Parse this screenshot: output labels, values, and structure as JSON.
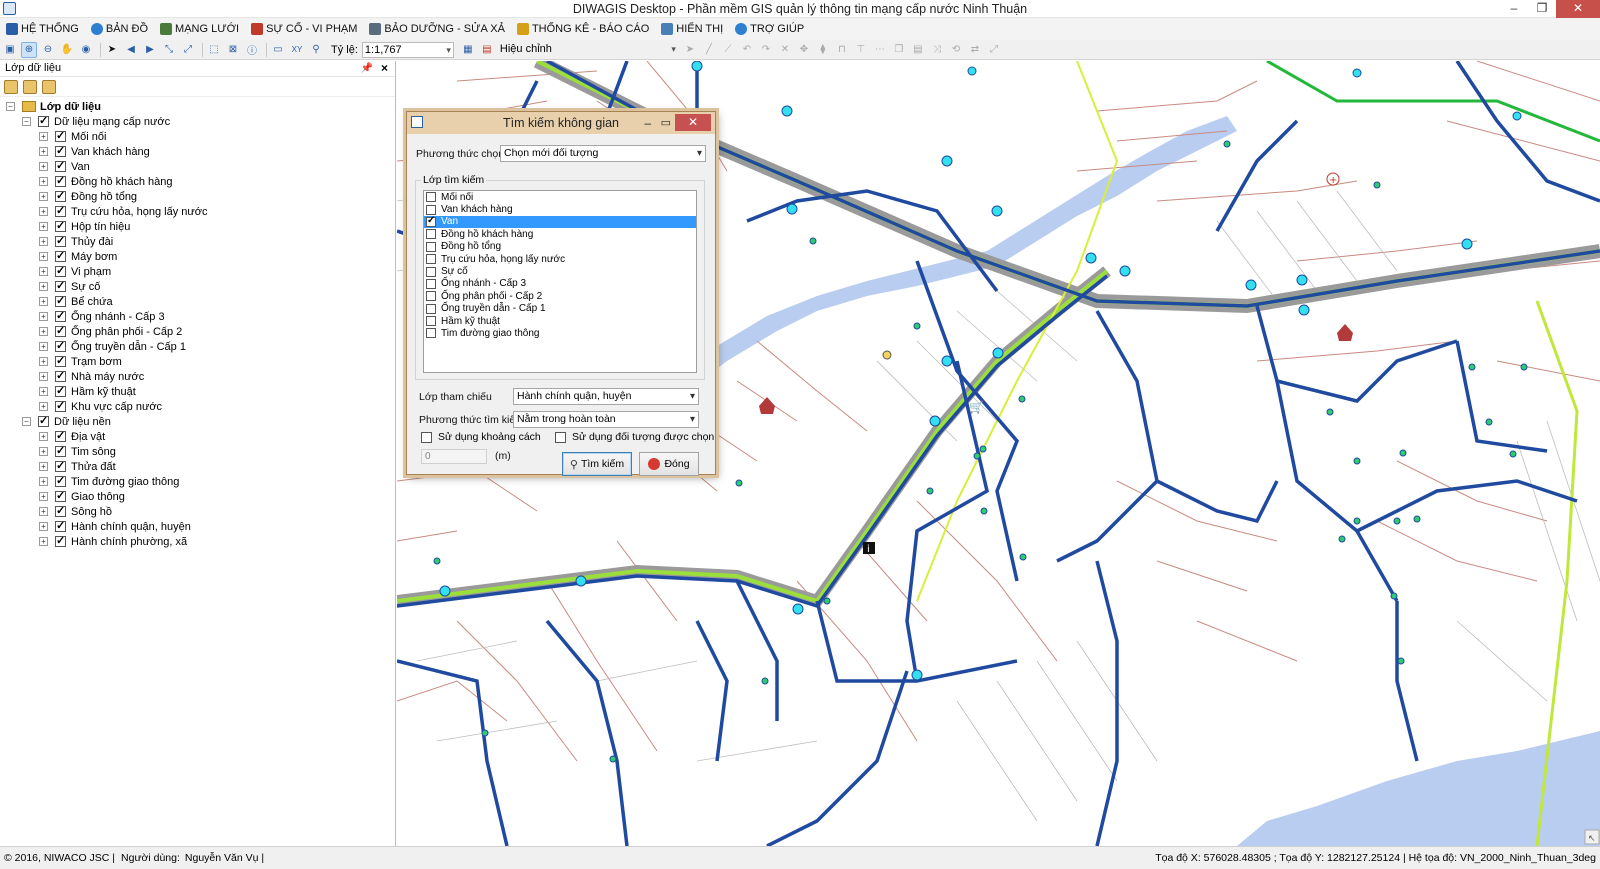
{
  "window": {
    "title": "DIWAGIS Desktop - Phần mềm GIS quản lý thông tin mạng cấp nước Ninh Thuận",
    "controls": {
      "minimize": "–",
      "maximize": "❐",
      "close": "✕"
    }
  },
  "menu": [
    {
      "label": "HỆ THỐNG",
      "icon": "system-icon",
      "color": "#2a5fa8"
    },
    {
      "label": "BẢN ĐỒ",
      "icon": "globe-icon",
      "color": "#2f7fd1"
    },
    {
      "label": "MẠNG LƯỚI",
      "icon": "network-icon",
      "color": "#4b7b3a"
    },
    {
      "label": "SỰ CỐ - VI PHẠM",
      "icon": "flag-icon",
      "color": "#c0392b"
    },
    {
      "label": "BẢO DƯỠNG - SỬA XẢ",
      "icon": "wrench-icon",
      "color": "#5a6b7d"
    },
    {
      "label": "THỐNG KÊ - BÁO CÁO",
      "icon": "report-icon",
      "color": "#d4a017"
    },
    {
      "label": "HIỂN THỊ",
      "icon": "display-icon",
      "color": "#4a7fb5"
    },
    {
      "label": "TRỢ GIÚP",
      "icon": "help-icon",
      "color": "#2f7fd1"
    }
  ],
  "toolbar": {
    "scale_label": "Tỷ lệ:",
    "scale_value": "1:1,767",
    "edit_mode": "Hiệu chỉnh"
  },
  "layer_panel": {
    "title": "Lớp dữ liệu",
    "root": "Lớp dữ liệu",
    "groups": [
      {
        "label": "Dữ liệu mạng cấp nước",
        "items": [
          "Mối nối",
          "Van khách hàng",
          "Van",
          "Đồng hồ khách hàng",
          "Đồng hồ tổng",
          "Trụ cứu hỏa, họng lấy nước",
          "Hộp tín hiệu",
          "Thủy đài",
          "Máy bơm",
          "Vi phạm",
          "Sự cố",
          "Bể chứa",
          "Ống nhánh - Cấp 3",
          "Ống phân phối - Cấp 2",
          "Ống truyền dẫn - Cấp 1",
          "Trạm bơm",
          "Nhà máy nước",
          "Hầm kỹ thuật",
          "Khu vực cấp nước"
        ]
      },
      {
        "label": "Dữ liệu nền",
        "items": [
          "Địa vật",
          "Tim sông",
          "Thửa đất",
          "Tim đường giao thông",
          "Giao thông",
          "Sông hồ",
          "Hành chính quận, huyện",
          "Hành chính phường, xã"
        ]
      }
    ]
  },
  "dialog": {
    "title": "Tìm kiếm không gian",
    "selection_method_label": "Phương thức chọn",
    "selection_method_value": "Chọn mới đối tượng",
    "search_layer_group": "Lớp tìm kiếm",
    "search_layers": [
      {
        "label": "Mối nối",
        "checked": false,
        "selected": false
      },
      {
        "label": "Van khách hàng",
        "checked": false,
        "selected": false
      },
      {
        "label": "Van",
        "checked": true,
        "selected": true
      },
      {
        "label": "Đồng hồ khách hàng",
        "checked": false,
        "selected": false
      },
      {
        "label": "Đồng hồ tổng",
        "checked": false,
        "selected": false
      },
      {
        "label": "Trụ cứu hỏa, họng lấy nước",
        "checked": false,
        "selected": false
      },
      {
        "label": "Sự cố",
        "checked": false,
        "selected": false
      },
      {
        "label": "Ống nhánh - Cấp 3",
        "checked": false,
        "selected": false
      },
      {
        "label": "Ống phân phối - Cấp 2",
        "checked": false,
        "selected": false
      },
      {
        "label": "Ống truyền dẫn - Cấp 1",
        "checked": false,
        "selected": false
      },
      {
        "label": "Hầm kỹ thuật",
        "checked": false,
        "selected": false
      },
      {
        "label": "Tim đường giao thông",
        "checked": false,
        "selected": false
      }
    ],
    "reference_layer_label": "Lớp tham chiếu",
    "reference_layer_value": "Hành chính quận, huyện",
    "search_method_label": "Phương thức tìm kiếm",
    "search_method_value": "Nằm trong hoàn toàn",
    "use_distance_label": "Sử dụng khoảng cách",
    "use_selected_label": "Sử dụng đối tượng được chọn",
    "distance_value": "0",
    "distance_unit": "(m)",
    "search_button": "Tìm kiếm",
    "close_button": "Đóng"
  },
  "status": {
    "copyright": "© 2016, NIWACO JSC |",
    "user_label": "Người dùng:",
    "user_name": "Nguyễn Văn Vụ |",
    "coords": "Tọa độ X: 576028.48305 ; Tọa độ Y: 1282127.25124 | Hệ tọa độ: VN_2000_Ninh_Thuan_3deg"
  },
  "colors": {
    "pipe_primary": "#1f4aa0",
    "pipe_transmission": "#9be03a",
    "parcel": "#c98a80",
    "river": "#b9cdf0",
    "node": "#33e0f0"
  }
}
